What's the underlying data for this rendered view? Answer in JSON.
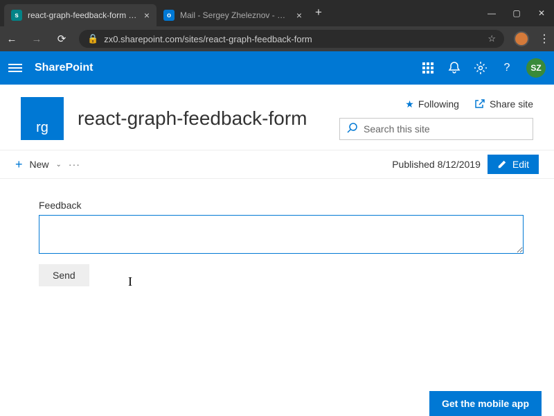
{
  "chrome": {
    "tabs": [
      {
        "title": "react-graph-feedback-form - Ho"
      },
      {
        "title": "Mail - Sergey Zheleznov - Outlo"
      }
    ],
    "url": "zx0.sharepoint.com/sites/react-graph-feedback-form"
  },
  "sp": {
    "brand": "SharePoint",
    "avatar": "SZ"
  },
  "site": {
    "logo": "rg",
    "title": "react-graph-feedback-form",
    "following": "Following",
    "share": "Share site",
    "search_placeholder": "Search this site"
  },
  "cmd": {
    "new_label": "New",
    "published": "Published 8/12/2019",
    "edit": "Edit"
  },
  "form": {
    "label": "Feedback",
    "send": "Send"
  },
  "mobile_label": "Get the mobile app"
}
